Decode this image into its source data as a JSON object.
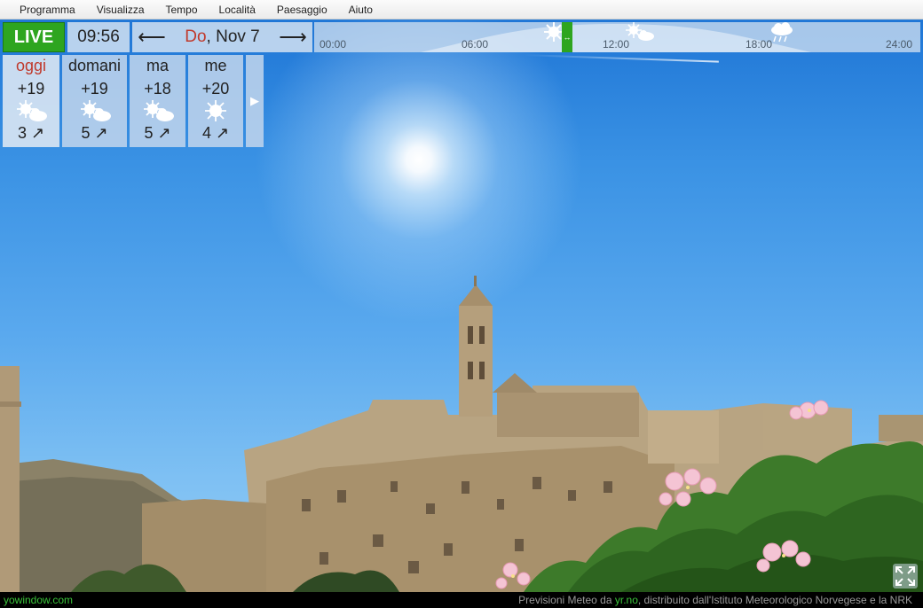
{
  "menu": [
    "Programma",
    "Visualizza",
    "Tempo",
    "Località",
    "Paesaggio",
    "Aiuto"
  ],
  "topbar": {
    "live_label": "LIVE",
    "time": "09:56",
    "prev_arrow": "⟵",
    "next_arrow": "⟶",
    "day_of_week": "Do",
    "date": ", Nov 7",
    "timeline_ticks": [
      "00:00",
      "06:00",
      "12:00",
      "18:00",
      "24:00"
    ],
    "timeline_icons": [
      "sun-icon",
      "sun-cloud-icon",
      "cloud-rain-icon"
    ]
  },
  "forecast": [
    {
      "day": "oggi",
      "temp": "+19",
      "icon": "sun-cloud-icon",
      "wind": "3 ↗"
    },
    {
      "day": "domani",
      "temp": "+19",
      "icon": "sun-cloud-icon",
      "wind": "5 ↗"
    },
    {
      "day": "ma",
      "temp": "+18",
      "icon": "sun-cloud-icon",
      "wind": "5 ↗"
    },
    {
      "day": "me",
      "temp": "+20",
      "icon": "sun-icon",
      "wind": "4 ↗"
    }
  ],
  "forecast_next": "▶",
  "status": {
    "site": "yowindow.com",
    "credit_prefix": "Previsioni Meteo da",
    "credit_link": "yr.no",
    "credit_suffix": ", distribuito dall'Istituto Meteorologico Norvegese e la NRK"
  },
  "colors": {
    "live": "#2ea51f",
    "accent_red": "#c0392b",
    "link_green": "#3ac23a"
  }
}
